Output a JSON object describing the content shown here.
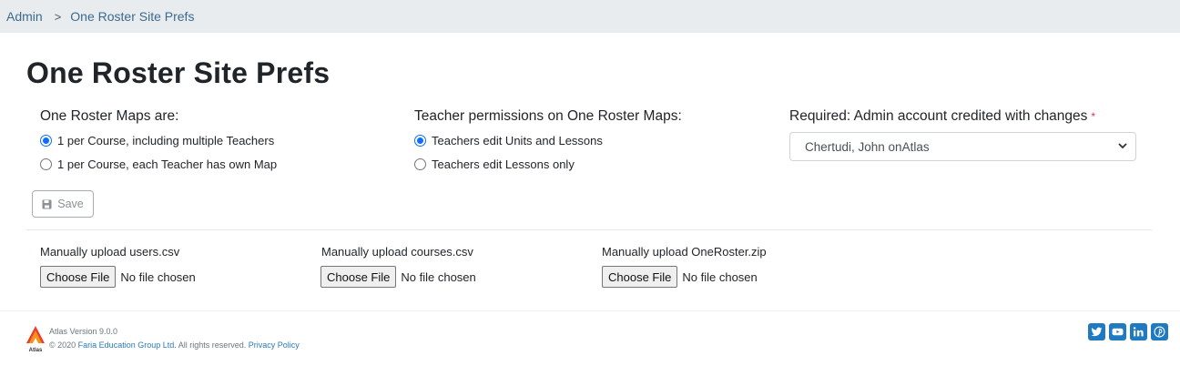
{
  "breadcrumb": {
    "root": "Admin",
    "separator": ">",
    "current": "One Roster Site Prefs"
  },
  "page": {
    "title": "One Roster Site Prefs"
  },
  "maps_group": {
    "label": "One Roster Maps are:",
    "options": [
      {
        "label": "1 per Course, including multiple Teachers",
        "checked": true
      },
      {
        "label": "1 per Course, each Teacher has own Map",
        "checked": false
      }
    ]
  },
  "permissions_group": {
    "label": "Teacher permissions on One Roster Maps:",
    "options": [
      {
        "label": "Teachers edit Units and Lessons",
        "checked": true
      },
      {
        "label": "Teachers edit Lessons only",
        "checked": false
      }
    ]
  },
  "admin_account": {
    "label": "Required: Admin account credited with changes",
    "required_marker": "*",
    "selected_value": "Chertudi, John onAtlas"
  },
  "toolbar": {
    "save_label": "Save"
  },
  "uploads": [
    {
      "label": "Manually upload users.csv",
      "button": "Choose File",
      "status": "No file chosen"
    },
    {
      "label": "Manually upload courses.csv",
      "button": "Choose File",
      "status": "No file chosen"
    },
    {
      "label": "Manually upload OneRoster.zip",
      "button": "Choose File",
      "status": "No file chosen"
    }
  ],
  "footer": {
    "logo_text": "Atlas",
    "version": "Atlas Version 9.0.0",
    "copyright_prefix": "© 2020",
    "company_link": "Faria Education Group Ltd.",
    "rights": "All rights reserved.",
    "privacy_link": "Privacy Policy",
    "social_icons": [
      "twitter-icon",
      "youtube-icon",
      "linkedin-icon",
      "pinterest-icon"
    ]
  },
  "colors": {
    "accent": "#0d6efd",
    "link": "#2a7ab8",
    "breadcrumb_bg": "#e9ecef",
    "required": "#dc3545",
    "social": "#1f7ac1"
  }
}
